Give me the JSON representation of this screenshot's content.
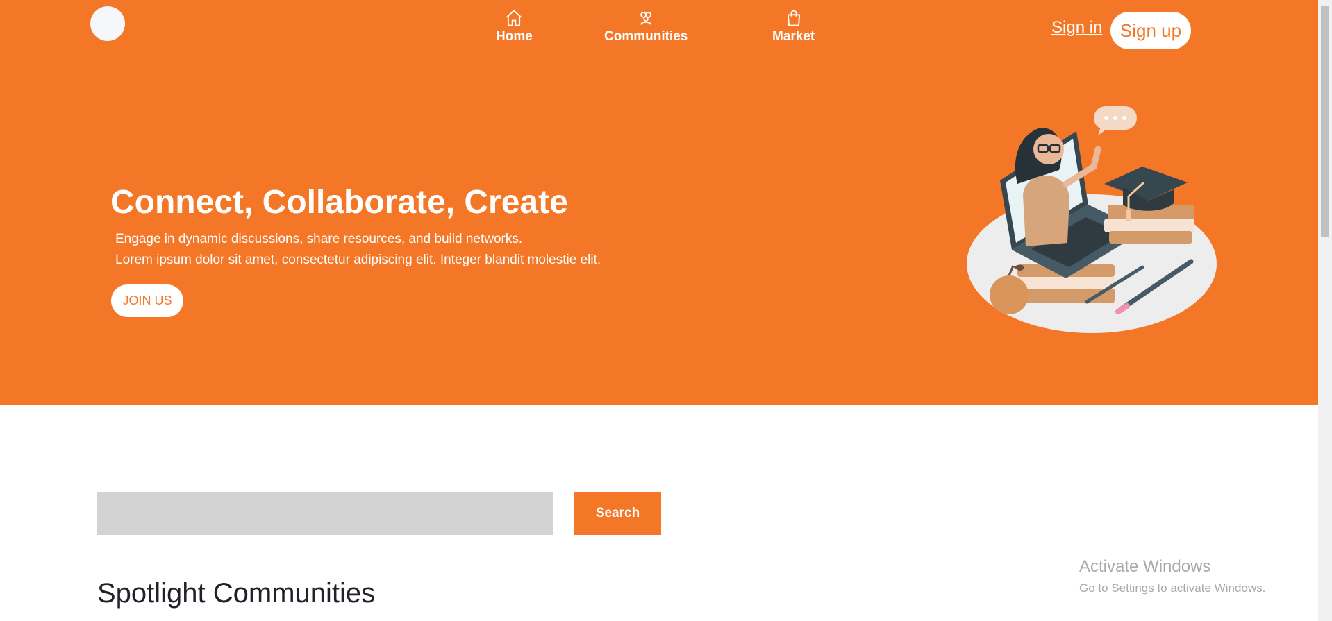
{
  "nav": {
    "items": [
      {
        "label": "Home",
        "icon": "home-icon"
      },
      {
        "label": "Communities",
        "icon": "users-icon"
      },
      {
        "label": "Market",
        "icon": "shopping-bag-icon"
      }
    ],
    "signin_label": "Sign in",
    "signup_label": "Sign up"
  },
  "hero": {
    "title": "Connect, Collaborate, Create",
    "line1": "Engage in dynamic discussions, share resources, and build networks.",
    "line2": "Lorem ipsum dolor sit amet, consectetur adipiscing elit. Integer blandit molestie elit.",
    "join_label": "JOIN US"
  },
  "search": {
    "value": "",
    "button_label": "Search"
  },
  "section": {
    "title": "Spotlight Communities"
  },
  "watermark": {
    "line1": "Activate Windows",
    "line2": "Go to Settings to activate Windows."
  },
  "colors": {
    "accent": "#f37727",
    "white": "#ffffff",
    "search_bg": "#d3d3d3",
    "heading": "#1f2329"
  }
}
